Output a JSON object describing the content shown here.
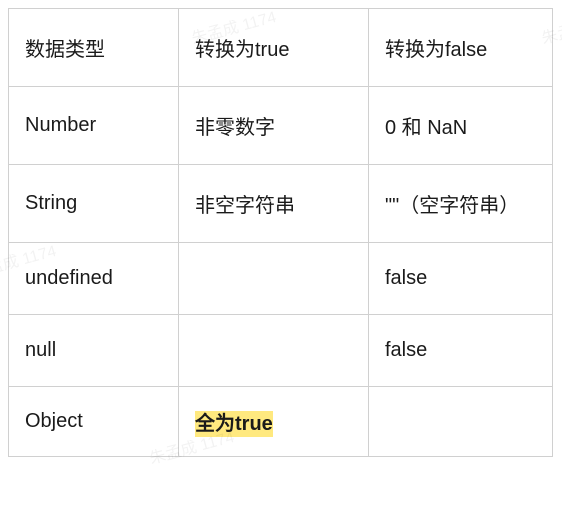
{
  "table": {
    "headers": [
      "数据类型",
      "转换为true",
      "转换为false"
    ],
    "rows": [
      {
        "type": "Number",
        "true": "非零数字",
        "false": "0 和 NaN"
      },
      {
        "type": "String",
        "true": "非空字符串",
        "false": "\"\"（空字符串）"
      },
      {
        "type": "undefined",
        "true": "",
        "false": "false"
      },
      {
        "type": "null",
        "true": "",
        "false": "false"
      },
      {
        "type": "Object",
        "true": "全为true",
        "false": ""
      }
    ]
  },
  "watermarks": [
    "朱孟成 1174",
    "朱孟成 1174",
    "朱孟成 1174",
    "朱孟成 1174"
  ],
  "chart_data": {
    "type": "table",
    "title": "",
    "columns": [
      "数据类型",
      "转换为true",
      "转换为false"
    ],
    "rows": [
      [
        "Number",
        "非零数字",
        "0 和 NaN"
      ],
      [
        "String",
        "非空字符串",
        "\"\"（空字符串）"
      ],
      [
        "undefined",
        "",
        "false"
      ],
      [
        "null",
        "",
        "false"
      ],
      [
        "Object",
        "全为true",
        ""
      ]
    ]
  }
}
